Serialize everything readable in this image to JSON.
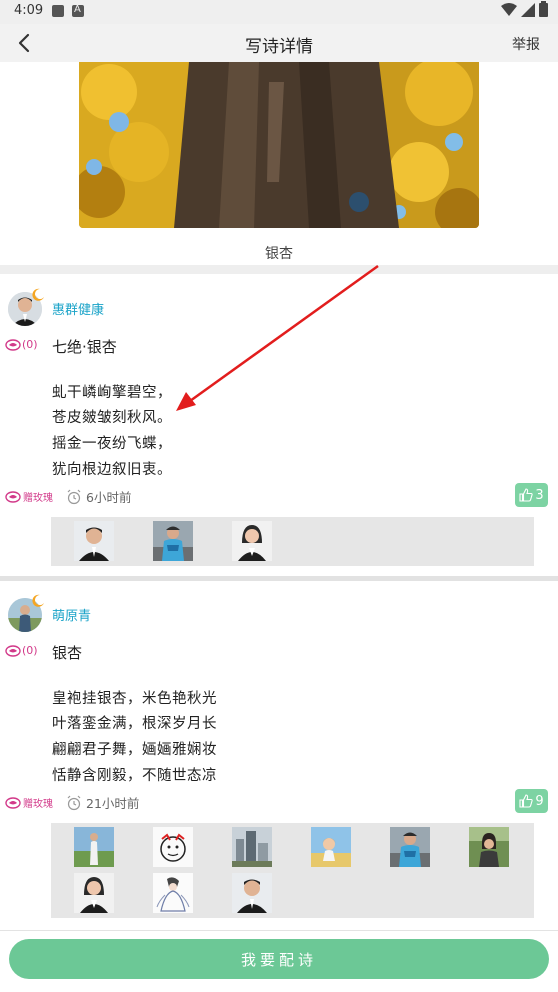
{
  "status_bar": {
    "time": "4:09",
    "icons": [
      "photo-icon",
      "a-icon",
      "wifi-icon",
      "signal-icon",
      "battery-icon"
    ]
  },
  "app_bar": {
    "title": "写诗详情",
    "report_label": "举报",
    "back_icon": "back-arrow-icon"
  },
  "header": {
    "caption": "银杏"
  },
  "entries": [
    {
      "username": "惠群健康",
      "rose_count": "(0)",
      "title": "七绝·银杏",
      "lines": [
        "虬干嶙峋擎碧空，",
        "苍皮皴皱刻秋风。",
        "摇金一夜纷飞蝶，",
        "犹向根边叙旧衷。"
      ],
      "gift_label": "赠玫瑰",
      "time": "6小时前",
      "likes": "3",
      "voter_count": 3
    },
    {
      "username": "萌原青",
      "rose_count": "(0)",
      "title": "银杏",
      "lines": [
        "皇袍挂银杏，米色艳秋光",
        "叶落銮金满，根深岁月长",
        "翩翩君子舞，婳婳雅娴妆",
        "恬静含刚毅，不随世态凉"
      ],
      "gift_label": "赠玫瑰",
      "time": "21小时前",
      "likes": "9",
      "voter_count": 9
    }
  ],
  "bottom": {
    "compose_label": "我要配诗"
  },
  "colors": {
    "accent_green": "#6cc896",
    "like_green": "#7dd3a3",
    "username_blue": "#1aa3c8",
    "rose_pink": "#d23a8a",
    "annotation_red": "#e21d1d"
  }
}
